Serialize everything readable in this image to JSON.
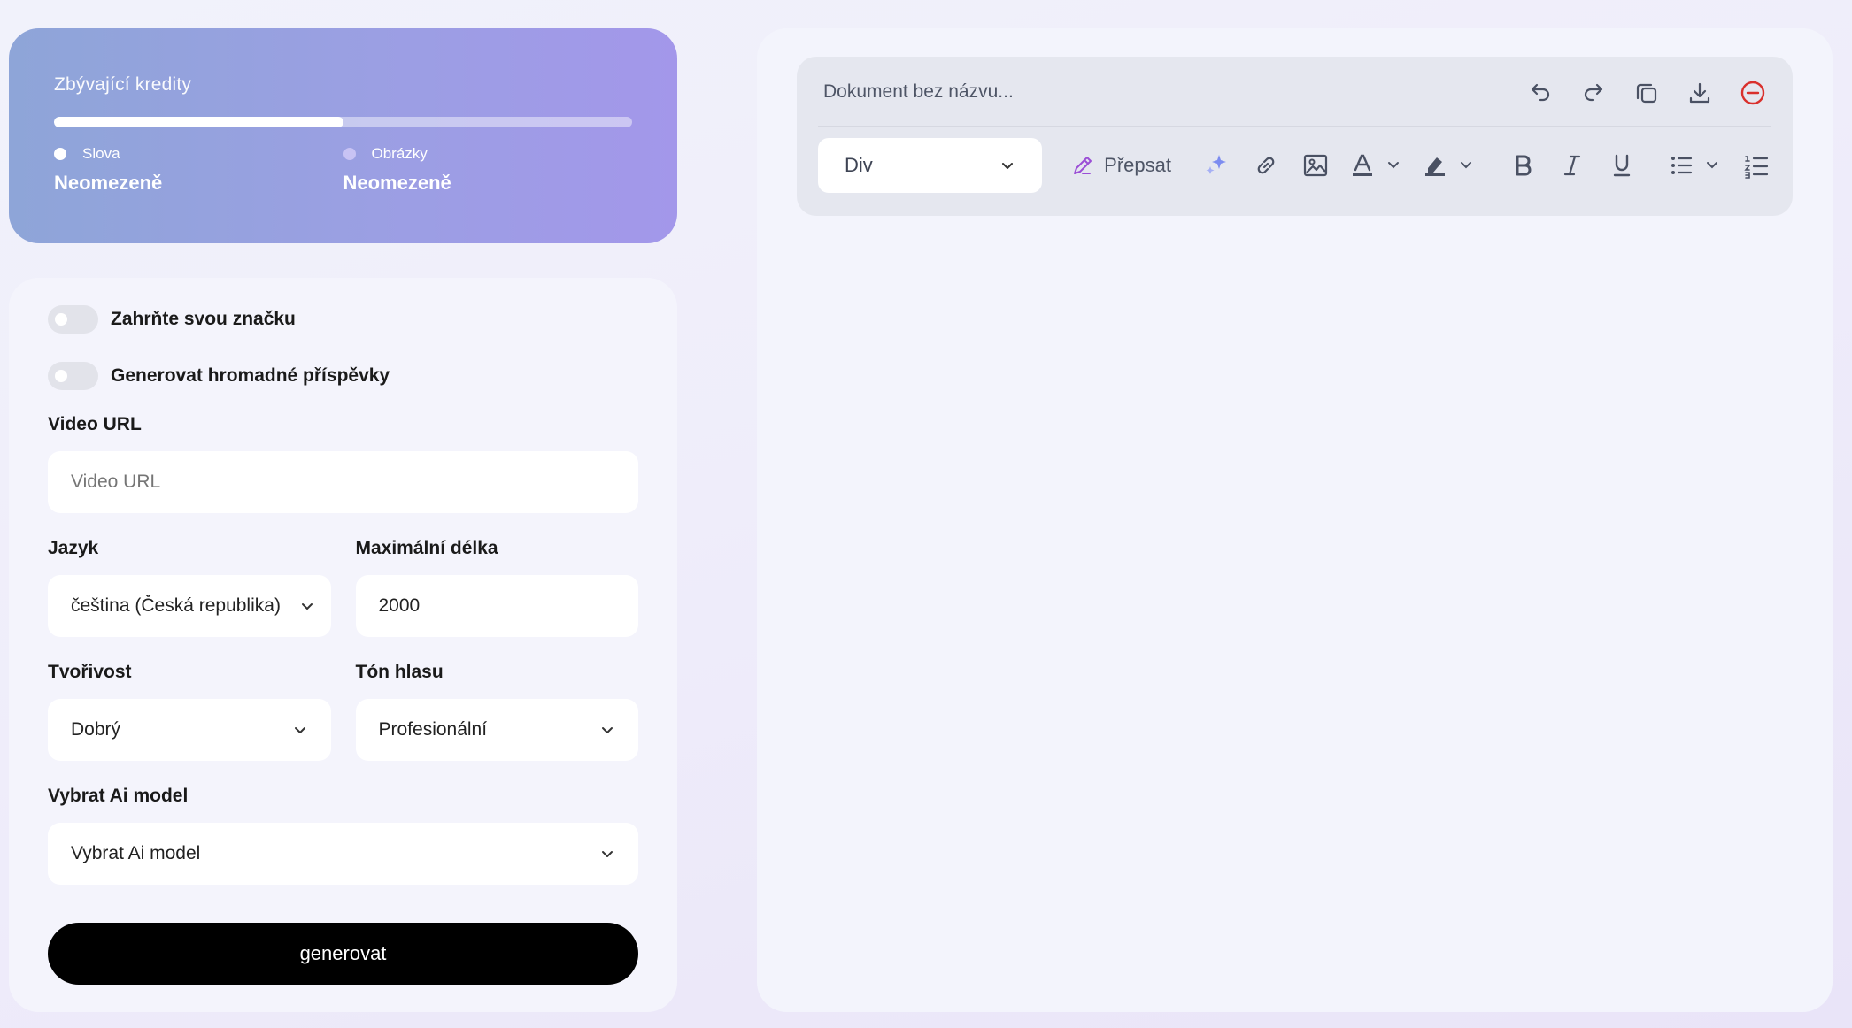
{
  "credits": {
    "title": "Zbývající kredity",
    "progress_fraction": 0.5,
    "words": {
      "label": "Slova",
      "value": "Neomezeně"
    },
    "images": {
      "label": "Obrázky",
      "value": "Neomezeně"
    }
  },
  "form": {
    "toggles": [
      {
        "label": "Zahrňte svou značku",
        "on": false
      },
      {
        "label": "Generovat hromadné příspěvky",
        "on": false
      }
    ],
    "video_url": {
      "label": "Video URL",
      "placeholder": "Video URL",
      "value": ""
    },
    "language": {
      "label": "Jazyk",
      "value": "čeština (Česká republika)"
    },
    "max_length": {
      "label": "Maximální délka",
      "value": "2000"
    },
    "creativity": {
      "label": "Tvořivost",
      "value": "Dobrý"
    },
    "tone": {
      "label": "Tón hlasu",
      "value": "Profesionální"
    },
    "ai_model": {
      "label": "Vybrat Ai model",
      "value": "Vybrat Ai model"
    },
    "generate_label": "generovat"
  },
  "editor": {
    "doc_title_placeholder": "Dokument bez názvu...",
    "block_type": "Div",
    "rewrite_label": "Přepsat",
    "icons": {
      "undo": "undo-icon",
      "redo": "redo-icon",
      "copy": "copy-icon",
      "download": "download-icon",
      "delete": "minus-circle-icon",
      "pencil": "pencil-icon",
      "sparkle": "sparkle-icon",
      "link": "link-icon",
      "image": "image-icon",
      "text_color": "text-color-icon",
      "highlight": "highlighter-icon",
      "bold": "bold-icon",
      "italic": "italic-icon",
      "underline": "underline-icon",
      "bullet_list": "bullet-list-icon",
      "ordered_list": "ordered-list-icon"
    },
    "colors": {
      "delete_red": "#d9302c",
      "sparkle_blue": "#7c8cf0",
      "pencil_purple": "#9b4fd6"
    }
  }
}
